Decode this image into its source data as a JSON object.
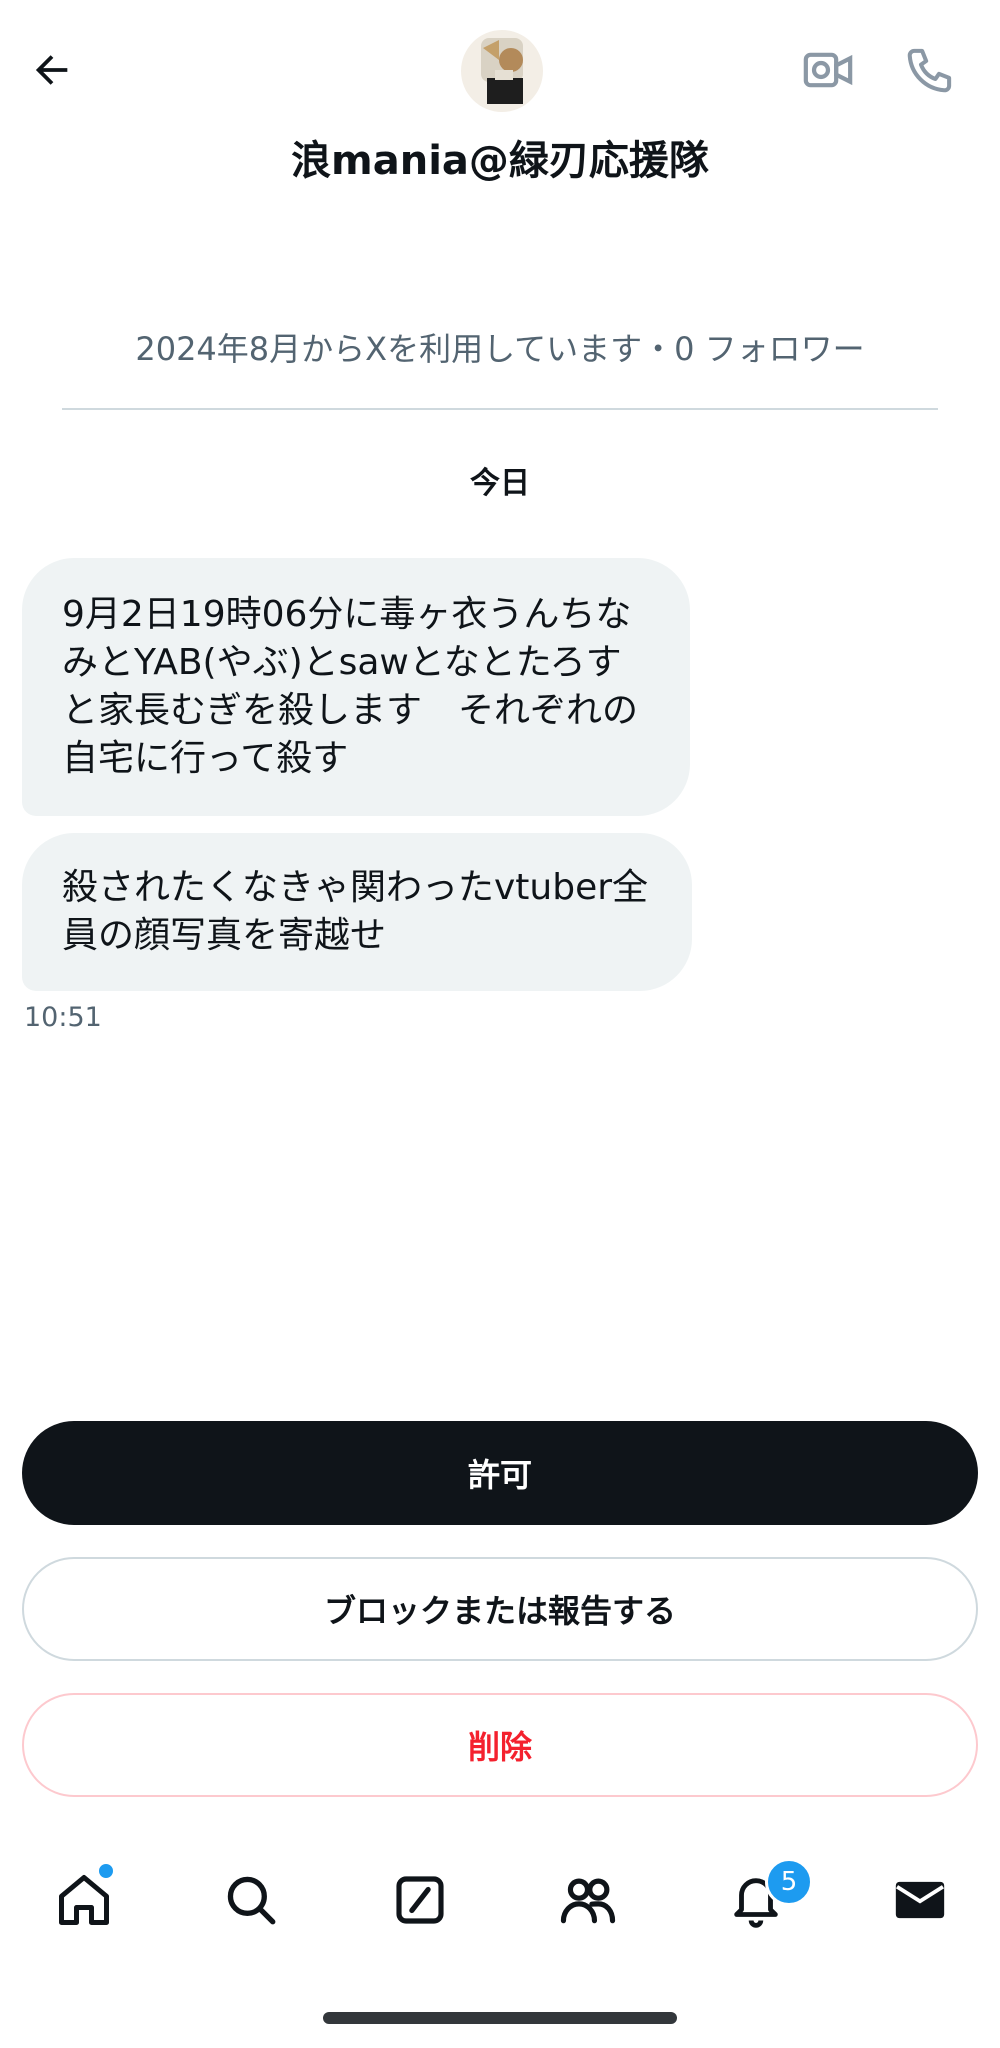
{
  "header": {
    "title": "浪mania@緑刃応援隊",
    "back_icon": "arrow-left-icon",
    "video_icon": "video-camera-icon",
    "call_icon": "phone-icon"
  },
  "profile_meta": "2024年8月からXを利用しています・0 フォロワー",
  "date_separator": "今日",
  "messages": [
    {
      "text": "9月2日19時06分に毒ヶ衣うんちなみとYAB(やぶ)とsawとなとたろすと家長むぎを殺します　それぞれの自宅に行って殺す"
    },
    {
      "text": "殺されたくなきゃ関わったvtuber全員の顔写真を寄越せ"
    }
  ],
  "timestamp": "10:51",
  "actions": {
    "allow_label": "許可",
    "block_label": "ブロックまたは報告する",
    "delete_label": "削除"
  },
  "tabbar": {
    "notifications_badge": "5",
    "colors": {
      "accent": "#1d9bf0",
      "danger": "#f4212e",
      "text": "#0f1419",
      "muted": "#536471"
    }
  }
}
